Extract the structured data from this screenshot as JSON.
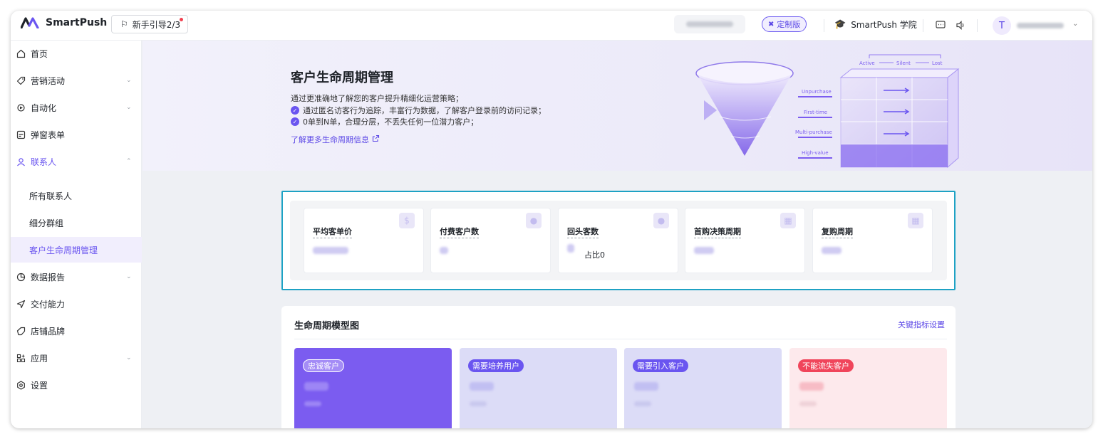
{
  "app": {
    "name": "SmartPush",
    "guide_label": "新手引导2/3",
    "edition_label": "定制版",
    "academy_label": "SmartPush 学院",
    "avatar_initial": "T"
  },
  "colors": {
    "brand": "#6a55f0",
    "highlight_border": "#1ea2c4",
    "loyal": "#7b5cf0",
    "nurture": "#dcdcf7",
    "attract": "#dcdcf7",
    "retain": "#fde9ec",
    "retain_tag": "#f0455b"
  },
  "sidebar": {
    "items": [
      {
        "label": "首页",
        "icon": "home-icon"
      },
      {
        "label": "营销活动",
        "icon": "tag-icon"
      },
      {
        "label": "自动化",
        "icon": "automation-icon"
      },
      {
        "label": "弹窗表单",
        "icon": "form-icon"
      },
      {
        "label": "联系人",
        "icon": "user-icon"
      },
      {
        "label": "所有联系人"
      },
      {
        "label": "细分群组"
      },
      {
        "label": "客户生命周期管理"
      },
      {
        "label": "数据报告",
        "icon": "pie-chart-icon"
      },
      {
        "label": "交付能力",
        "icon": "send-icon"
      },
      {
        "label": "店铺品牌",
        "icon": "brand-icon"
      },
      {
        "label": "应用",
        "icon": "apps-icon"
      },
      {
        "label": "设置",
        "icon": "settings-icon"
      }
    ]
  },
  "banner": {
    "title": "客户生命周期管理",
    "description": "通过更准确地了解您的客户提升精细化运营策略；",
    "point1": "通过匿名访客行为追踪，丰富行为数据，了解客户登录前的访问记录；",
    "point2": "0单到N单，合理分层，不丢失任何一位潜力客户；",
    "link": "了解更多生命周期信息",
    "illustration": {
      "flow_active": "Active",
      "flow_silent": "Silent",
      "flow_lost": "Lost",
      "label_unpurchase": "Unpurchase",
      "label_first_time": "First-time",
      "label_multi_purchase": "Multi-purchase",
      "label_high_value": "High-value"
    }
  },
  "metrics": [
    {
      "label": "平均客单价",
      "icon": "dollar-icon"
    },
    {
      "label": "付费客户数",
      "icon": "person-icon"
    },
    {
      "label": "回头客数",
      "icon": "person-icon",
      "extra": "占比0"
    },
    {
      "label": "首购决策周期",
      "icon": "calendar-icon"
    },
    {
      "label": "复购周期",
      "icon": "calendar-icon"
    }
  ],
  "lifecycle": {
    "title": "生命周期模型图",
    "settings_link": "关键指标设置",
    "segments": [
      {
        "tag": "忠诚客户"
      },
      {
        "tag": "需要培养用户"
      },
      {
        "tag": "需要引入客户"
      },
      {
        "tag": "不能流失客户"
      }
    ]
  }
}
